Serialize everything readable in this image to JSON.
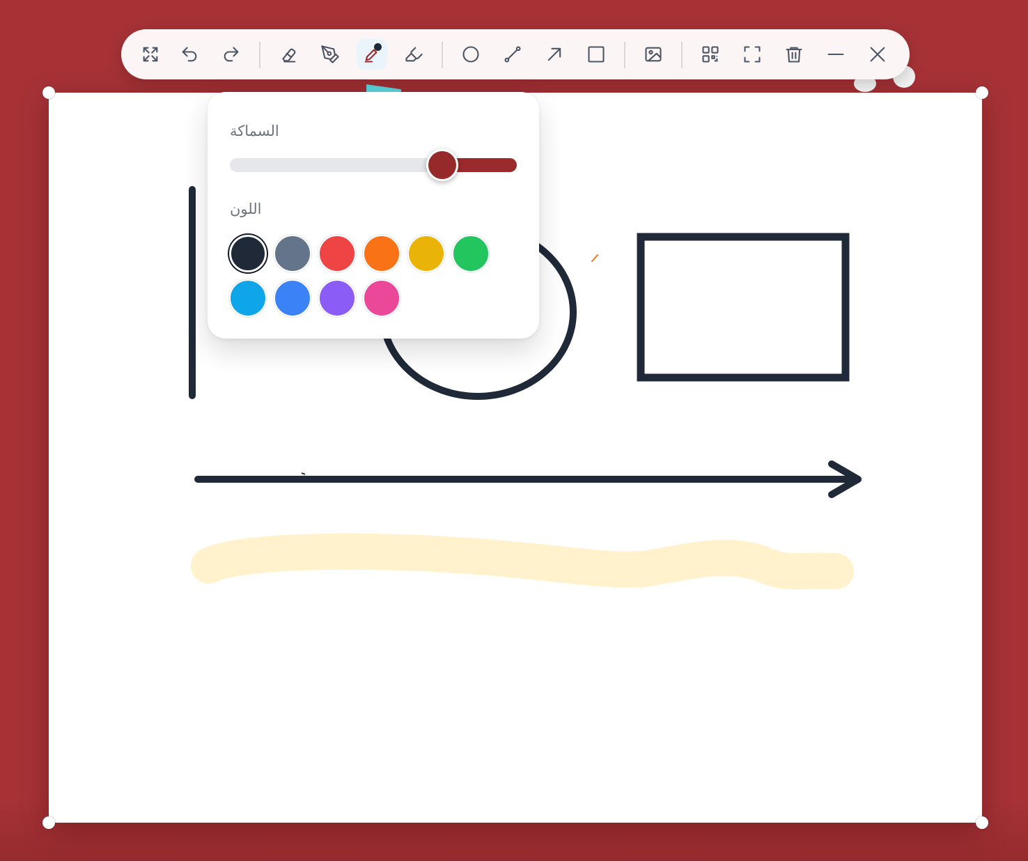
{
  "colors": {
    "background": "#a63236",
    "board": "#ffffff",
    "stroke": "#1f2937",
    "highlight": "#fff2cc",
    "accent": "#962a2b"
  },
  "toolbar": {
    "tools": [
      {
        "name": "expand-tool",
        "icon": "expand-arrows-icon"
      },
      {
        "name": "undo-button",
        "icon": "undo-icon"
      },
      {
        "name": "redo-button",
        "icon": "redo-icon"
      },
      {
        "name": "eraser-tool",
        "icon": "eraser-icon"
      },
      {
        "name": "pen-nib-tool",
        "icon": "pen-nib-icon"
      },
      {
        "name": "marker-tool",
        "icon": "marker-icon",
        "active": true
      },
      {
        "name": "highlighter-tool",
        "icon": "highlighter-icon"
      },
      {
        "name": "circle-tool",
        "icon": "circle-icon"
      },
      {
        "name": "line-tool",
        "icon": "line-icon"
      },
      {
        "name": "arrow-tool",
        "icon": "arrow-icon"
      },
      {
        "name": "rectangle-tool",
        "icon": "square-icon"
      },
      {
        "name": "image-tool",
        "icon": "image-icon"
      },
      {
        "name": "qr-code-button",
        "icon": "qr-code-icon"
      },
      {
        "name": "fullscreen-button",
        "icon": "fullscreen-icon"
      },
      {
        "name": "delete-button",
        "icon": "trash-icon"
      },
      {
        "name": "minimize-button",
        "icon": "minus-icon"
      },
      {
        "name": "close-button",
        "icon": "close-icon"
      }
    ]
  },
  "popover": {
    "thickness_label": "السماكة",
    "color_label": "اللون",
    "thickness_value": 0.74,
    "swatches": [
      "#1f2937",
      "#64748b",
      "#ef4444",
      "#f97316",
      "#eab308",
      "#22c55e",
      "#0ea5e9",
      "#3b82f6",
      "#8b5cf6",
      "#ec4899"
    ],
    "selected_swatch": 0
  }
}
